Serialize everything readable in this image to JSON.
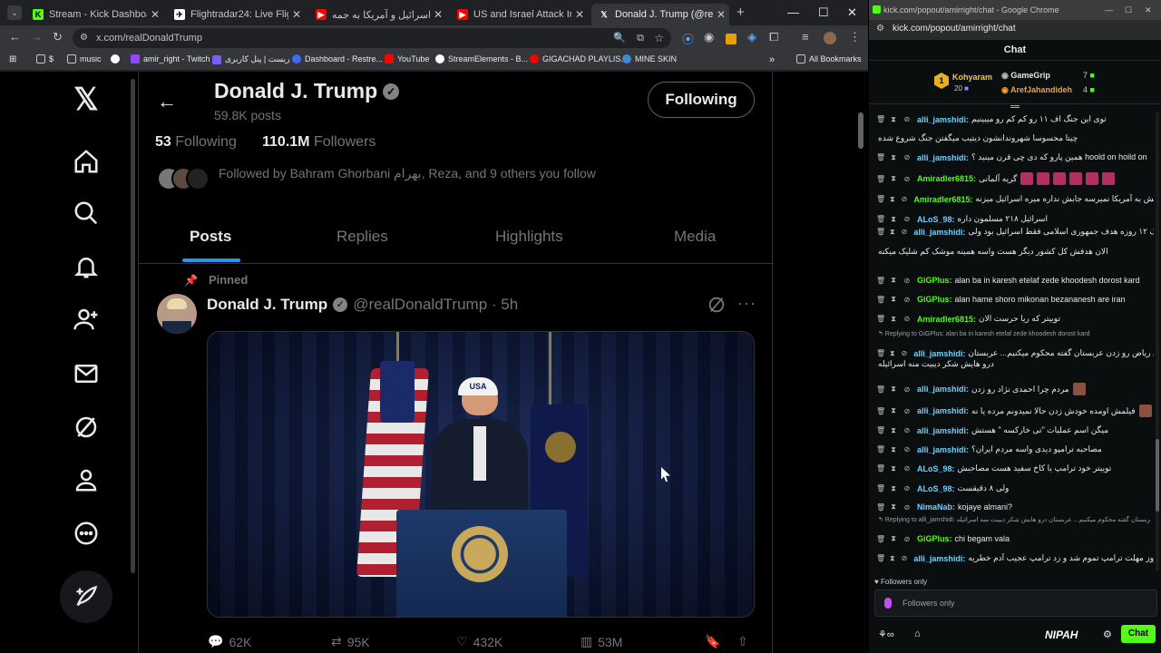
{
  "browser": {
    "tabs": [
      {
        "label": "Stream - Kick Dashboard",
        "icon": "kick-icon"
      },
      {
        "label": "Flightradar24: Live Flight Track",
        "icon": "flightradar-icon"
      },
      {
        "label": "آغاز حمله اسرائیل و آمریکا به جمه",
        "icon": "youtube-icon"
      },
      {
        "label": "US and Israel Attack Iran - LIVE",
        "icon": "youtube-icon"
      },
      {
        "label": "Donald J. Trump (@realDo",
        "icon": "x-icon"
      }
    ],
    "url": "x.com/realDonaldTrump",
    "bookmarks": [
      "$",
      "music",
      "amir_right - Twitch",
      "ریست | پنل کاربری",
      "Dashboard - Restre...",
      "YouTube",
      "StreamElements - B...",
      "GIGACHAD PLAYLIS...",
      "MINE SKIN"
    ],
    "all_bookmarks": "All Bookmarks"
  },
  "profile": {
    "name": "Donald J. Trump",
    "posts": "59.8K posts",
    "following_btn": "Following",
    "following_count": "53",
    "following_label": "Following",
    "followers_count": "110.1M",
    "followers_label": "Followers",
    "followed_by": "Followed by Bahram Ghorbani بهرام, Reza, and 9 others you follow",
    "tabs": [
      "Posts",
      "Replies",
      "Highlights",
      "Media"
    ]
  },
  "post": {
    "pinned": "Pinned",
    "name": "Donald J. Trump",
    "handle": "@realDonaldTrump · 5h",
    "replies": "62K",
    "reposts": "95K",
    "likes": "432K",
    "views": "53M"
  },
  "chat_window": {
    "title": "kick.com/popout/amirright/chat - Google Chrome",
    "url": "kick.com/popout/amirright/chat",
    "header": "Chat",
    "leaderboard": [
      {
        "rank": "1",
        "name": "Kohyaram",
        "count": "20"
      },
      {
        "name": "GameGrip",
        "count": "7"
      },
      {
        "name": "ArefJahandideh",
        "count": "4"
      }
    ],
    "messages": [
      {
        "user": "alli_jamshidi",
        "color": "#6dd2ff",
        "text": "توی این جنگ اف ۱۱ رو کم کم رو میبینیم"
      },
      {
        "user": "",
        "color": "#ffffff",
        "text": "چیتا محسوسا شهروندانشون دیتیب میگفتن جنگ شروع شده"
      },
      {
        "user": "alli_jamshidi",
        "color": "#6dd2ff",
        "text": "همین پارو که دی چی قرن مینید ؟ hoold on hoild on"
      },
      {
        "user": "Amiradler6815",
        "color": "#53fc18",
        "text": "گریه آلمانی"
      },
      {
        "user": "Amiradler6815",
        "color": "#53fc18",
        "text": "دستش به آمریکا نمیرسه جابش نداره میره اسرائیل میزنه"
      },
      {
        "user": "ALoS_98",
        "color": "#6dd2ff",
        "text": "اسرائیل ۲۱۸ مسلمون داره"
      },
      {
        "user": "alli_jamshidi",
        "color": "#6dd2ff",
        "text": "تو جنگ ۱۲ روزه هدف جمهوری اسلامی فقط اسرائیل بود ولی"
      },
      {
        "user": "",
        "color": "#ffffff",
        "text": "الان هدفش کل کشور دیگر هست واسه همینه موشک کم شلیک میکنه"
      },
      {
        "user": "GiGPlus",
        "color": "#53fc18",
        "text": "alan ba in karesh etelaf zede khoodesh dorost kard"
      },
      {
        "user": "GiGPlus",
        "color": "#53fc18",
        "text": "alan hame shoro mikonan bezananesh are iran"
      },
      {
        "user": "Amiradler6815",
        "color": "#53fc18",
        "text": "توییتر که ریا حرست الان"
      },
      {
        "reply": "Replying to GiGPlus: alan ba in karesh etelaf zede khoodesh dorost kard"
      },
      {
        "user": "alli_jamshidi",
        "color": "#6dd2ff",
        "text": "رفتن ریاض رو زدن عربستان گفته محکوم میکنیم... عربستان"
      },
      {
        "user": "",
        "color": "#ffffff",
        "text": "درو هایش شکر دیبیت منه اسرائیله"
      },
      {
        "user": "alli_jamshidi",
        "color": "#6dd2ff",
        "text": "مردم چرا احمدی نژاد رو زدن"
      },
      {
        "user": "alli_jamshidi",
        "color": "#6dd2ff",
        "text": "فیلمش اومده خودش زدن حالا نمیدونم مرده یا نه"
      },
      {
        "user": "alli_jamshidi",
        "color": "#6dd2ff",
        "text": "میگن اسم عملیات \"تی خارکسه \" هستش"
      },
      {
        "user": "alli_jamshidi",
        "color": "#6dd2ff",
        "text": "مصاحبه ترامپو دیدی واسه مردم ایران؟"
      },
      {
        "user": "ALoS_98",
        "color": "#6dd2ff",
        "text": "توییتر خود ترامپ یا کاخ سفید هست مصاحبش"
      },
      {
        "user": "ALoS_98",
        "color": "#6dd2ff",
        "text": "ولی ۸ دقیقست"
      },
      {
        "user": "NimaNab",
        "color": "#6dd2ff",
        "text": "kojaye almani?"
      },
      {
        "reply": "Replying to alli_jamshidi: رفتن ریاض رو زدن عربستان گفته محکوم میکنیم... عربستان درو هایش شکر دیبیت منه اسرائیله"
      },
      {
        "user": "GiGPlus",
        "color": "#53fc18",
        "text": "chi begam vala"
      },
      {
        "user": "alli_jamshidi",
        "color": "#6dd2ff",
        "text": "دقیقا امروز مهلت ترامپ تموم شد و زد ترامپ عجیب آدم خطریه"
      }
    ],
    "followers_only_note": "Followers only",
    "input_placeholder": "Followers only",
    "brand": "NIPAH",
    "chat_button": "Chat"
  }
}
